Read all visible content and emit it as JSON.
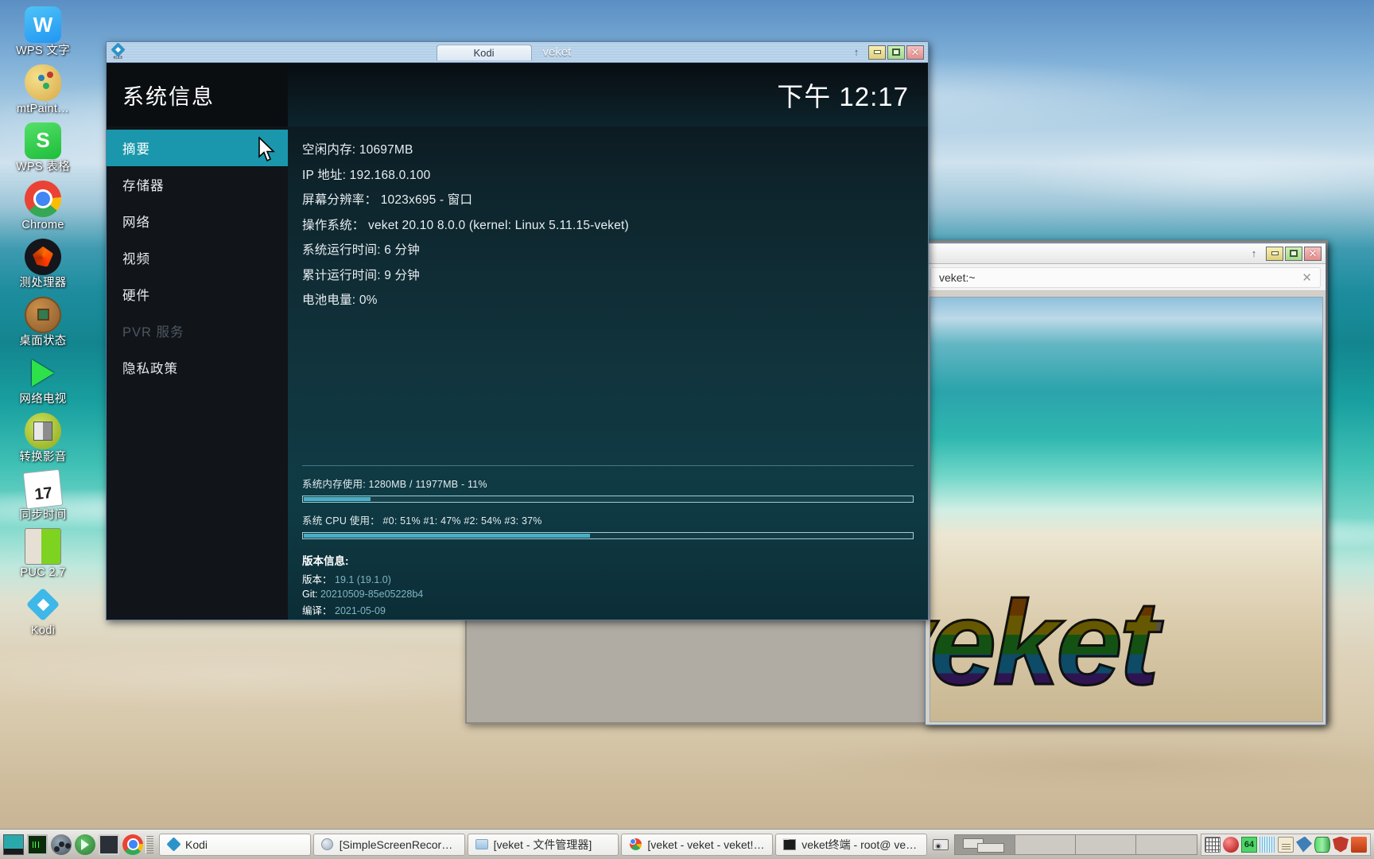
{
  "desktop": {
    "icons": [
      {
        "name": "wps-writer",
        "label": "WPS 文字",
        "art": "ic-wps-w",
        "glyph": "W"
      },
      {
        "name": "mtpaint",
        "label": "mtPaint…",
        "art": "ic-palette",
        "glyph": ""
      },
      {
        "name": "wps-sheets",
        "label": "WPS 表格",
        "art": "ic-wps-s",
        "glyph": "S"
      },
      {
        "name": "chrome",
        "label": "Chrome",
        "art": "ic-chrome",
        "glyph": ""
      },
      {
        "name": "cpu-test",
        "label": "测处理器",
        "art": "ic-proc",
        "glyph": ""
      },
      {
        "name": "desktop-state",
        "label": "桌面状态",
        "art": "ic-coin",
        "glyph": ""
      },
      {
        "name": "net-tv",
        "label": "网络电视",
        "art": "ic-play",
        "glyph": ""
      },
      {
        "name": "convert-av",
        "label": "转换影音",
        "art": "ic-conv",
        "glyph": ""
      },
      {
        "name": "sync-time",
        "label": "同步时间",
        "art": "ic-cal",
        "glyph": "17"
      },
      {
        "name": "puc",
        "label": "PUC 2.7",
        "art": "ic-puc",
        "glyph": ""
      },
      {
        "name": "kodi",
        "label": "Kodi",
        "art": "ic-kodi",
        "glyph": ""
      }
    ]
  },
  "kodi_window": {
    "titlebar": {
      "app_icon_label": "KODI",
      "tab_label": "Kodi",
      "window_title": "veket",
      "shade_icon": "↑",
      "minimize_label": "",
      "maximize_label": "",
      "close_label": "✕"
    },
    "heading": "系统信息",
    "clock": "下午 12:17",
    "menu": [
      {
        "label": "摘要",
        "state": "selected"
      },
      {
        "label": "存储器",
        "state": "normal"
      },
      {
        "label": "网络",
        "state": "normal"
      },
      {
        "label": "视频",
        "state": "normal"
      },
      {
        "label": "硬件",
        "state": "normal"
      },
      {
        "label": "PVR 服务",
        "state": "disabled"
      },
      {
        "label": "隐私政策",
        "state": "normal"
      }
    ],
    "info_lines": [
      "空闲内存: 10697MB",
      "IP 地址: 192.168.0.100",
      "屏幕分辨率： 1023x695 - 窗口",
      "操作系统： veket 20.10 8.0.0 (kernel: Linux 5.11.15-veket)",
      "系统运行时间: 6 分钟",
      "累计运行时间: 9 分钟",
      "电池电量: 0%"
    ],
    "stats": {
      "memory_label": "系统内存使用: 1280MB / 11977MB - 11%",
      "memory_percent": 11,
      "cpu_label": "系统 CPU 使用： #0: 51% #1: 47% #2: 54% #3: 37%",
      "cpu_percent": 47
    },
    "version": {
      "title": "版本信息:",
      "rows": [
        {
          "key": "版本：",
          "value": "19.1 (19.1.0)"
        },
        {
          "key": "Git:",
          "value": "20210509-85e05228b4"
        },
        {
          "key": "编译：",
          "value": "2021-05-09"
        }
      ]
    }
  },
  "terminal_window": {
    "titlebar": {
      "shade_icon": "↑",
      "close_label": "✕"
    },
    "tab_label": "veket:~",
    "tab_close": "✕",
    "wallpaper_text": "veket"
  },
  "taskbar": {
    "launchers": [
      {
        "name": "show-desktop-icon",
        "art": "l-desk"
      },
      {
        "name": "system-monitor-icon",
        "art": "l-mon"
      },
      {
        "name": "media-player-icon",
        "art": "l-film"
      },
      {
        "name": "play-launcher-icon",
        "art": "l-green"
      },
      {
        "name": "screen-launcher-icon",
        "art": "l-screen"
      },
      {
        "name": "chrome-launcher-icon",
        "art": "l-chrome"
      }
    ],
    "tasks": [
      {
        "name": "task-kodi",
        "label": "Kodi",
        "icon": "ti-kodi",
        "active": true
      },
      {
        "name": "task-ssr",
        "label": "[SimpleScreenRecord…",
        "icon": "ti-ssr",
        "active": false
      },
      {
        "name": "task-filemgr",
        "label": "[veket - 文件管理器]",
        "icon": "ti-fm",
        "active": false
      },
      {
        "name": "task-chrome",
        "label": "[veket - veket - veket!…",
        "icon": "ti-chr",
        "active": false
      },
      {
        "name": "task-terminal",
        "label": "veket终端 - root@ vek…",
        "icon": "ti-term",
        "active": false
      }
    ],
    "tray": {
      "screenshot_icon": "camera-icon",
      "workspaces": [
        {
          "name": "workspace-1",
          "active": true
        },
        {
          "name": "workspace-2",
          "active": false
        },
        {
          "name": "workspace-3",
          "active": false
        },
        {
          "name": "workspace-4",
          "active": false
        }
      ],
      "icons": [
        {
          "name": "keyboard-layout-icon",
          "art": "tic-kbd",
          "text": ""
        },
        {
          "name": "record-indicator-icon",
          "art": "tic-ball",
          "text": ""
        },
        {
          "name": "arch-64-icon",
          "art": "tic-64",
          "text": "64"
        },
        {
          "name": "flag-icon",
          "art": "tic-flag",
          "text": ""
        },
        {
          "name": "clipboard-icon",
          "art": "tic-note",
          "text": ""
        },
        {
          "name": "network-icon",
          "art": "tic-blue",
          "text": ""
        },
        {
          "name": "battery-icon",
          "art": "tic-cyl",
          "text": ""
        },
        {
          "name": "firewall-icon",
          "art": "tic-shield",
          "text": ""
        },
        {
          "name": "updates-icon",
          "art": "tic-last",
          "text": ""
        }
      ]
    }
  }
}
